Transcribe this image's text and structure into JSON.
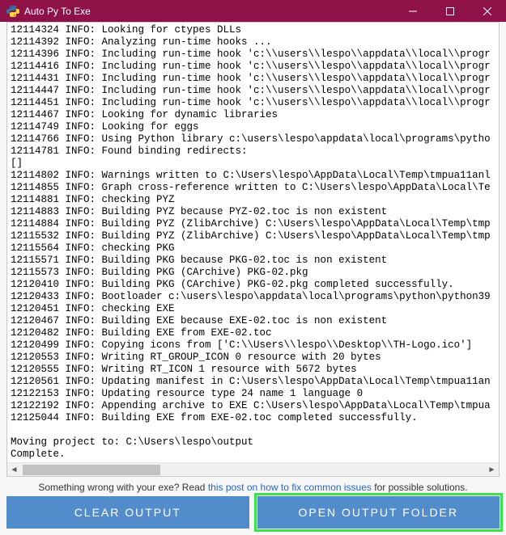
{
  "titlebar": {
    "title": "Auto Py To Exe"
  },
  "output": {
    "lines": [
      "12114324 INFO: Looking for ctypes DLLs",
      "12114392 INFO: Analyzing run-time hooks ...",
      "12114396 INFO: Including run-time hook 'c:\\\\users\\\\lespo\\\\appdata\\\\local\\\\progr",
      "12114416 INFO: Including run-time hook 'c:\\\\users\\\\lespo\\\\appdata\\\\local\\\\progr",
      "12114431 INFO: Including run-time hook 'c:\\\\users\\\\lespo\\\\appdata\\\\local\\\\progr",
      "12114447 INFO: Including run-time hook 'c:\\\\users\\\\lespo\\\\appdata\\\\local\\\\progr",
      "12114451 INFO: Including run-time hook 'c:\\\\users\\\\lespo\\\\appdata\\\\local\\\\progr",
      "12114467 INFO: Looking for dynamic libraries",
      "12114749 INFO: Looking for eggs",
      "12114766 INFO: Using Python library c:\\users\\lespo\\appdata\\local\\programs\\pytho",
      "12114781 INFO: Found binding redirects:",
      "[]",
      "12114802 INFO: Warnings written to C:\\Users\\lespo\\AppData\\Local\\Temp\\tmpua11anl",
      "12114855 INFO: Graph cross-reference written to C:\\Users\\lespo\\AppData\\Local\\Te",
      "12114881 INFO: checking PYZ",
      "12114883 INFO: Building PYZ because PYZ-02.toc is non existent",
      "12114884 INFO: Building PYZ (ZlibArchive) C:\\Users\\lespo\\AppData\\Local\\Temp\\tmp",
      "12115532 INFO: Building PYZ (ZlibArchive) C:\\Users\\lespo\\AppData\\Local\\Temp\\tmp",
      "12115564 INFO: checking PKG",
      "12115571 INFO: Building PKG because PKG-02.toc is non existent",
      "12115573 INFO: Building PKG (CArchive) PKG-02.pkg",
      "12120410 INFO: Building PKG (CArchive) PKG-02.pkg completed successfully.",
      "12120433 INFO: Bootloader c:\\users\\lespo\\appdata\\local\\programs\\python\\python39",
      "12120451 INFO: checking EXE",
      "12120467 INFO: Building EXE because EXE-02.toc is non existent",
      "12120482 INFO: Building EXE from EXE-02.toc",
      "12120499 INFO: Copying icons from ['C:\\\\Users\\\\lespo\\\\Desktop\\\\TH-Logo.ico']",
      "12120553 INFO: Writing RT_GROUP_ICON 0 resource with 20 bytes",
      "12120555 INFO: Writing RT_ICON 1 resource with 5672 bytes",
      "12120561 INFO: Updating manifest in C:\\Users\\lespo\\AppData\\Local\\Temp\\tmpua11an",
      "12122153 INFO: Updating resource type 24 name 1 language 0",
      "12122192 INFO: Appending archive to EXE C:\\Users\\lespo\\AppData\\Local\\Temp\\tmpua",
      "12125044 INFO: Building EXE from EXE-02.toc completed successfully.",
      "",
      "Moving project to: C:\\Users\\lespo\\output",
      "Complete.",
      ""
    ]
  },
  "footer": {
    "prefix": "Something wrong with your exe? Read ",
    "link": "this post on how to fix common issues",
    "suffix": " for possible solutions."
  },
  "buttons": {
    "clear": "CLEAR OUTPUT",
    "open": "OPEN OUTPUT FOLDER"
  },
  "colors": {
    "titlebar": "#8e1148",
    "button": "#538ccb",
    "highlight": "#3be24a",
    "link": "#2765c6"
  }
}
